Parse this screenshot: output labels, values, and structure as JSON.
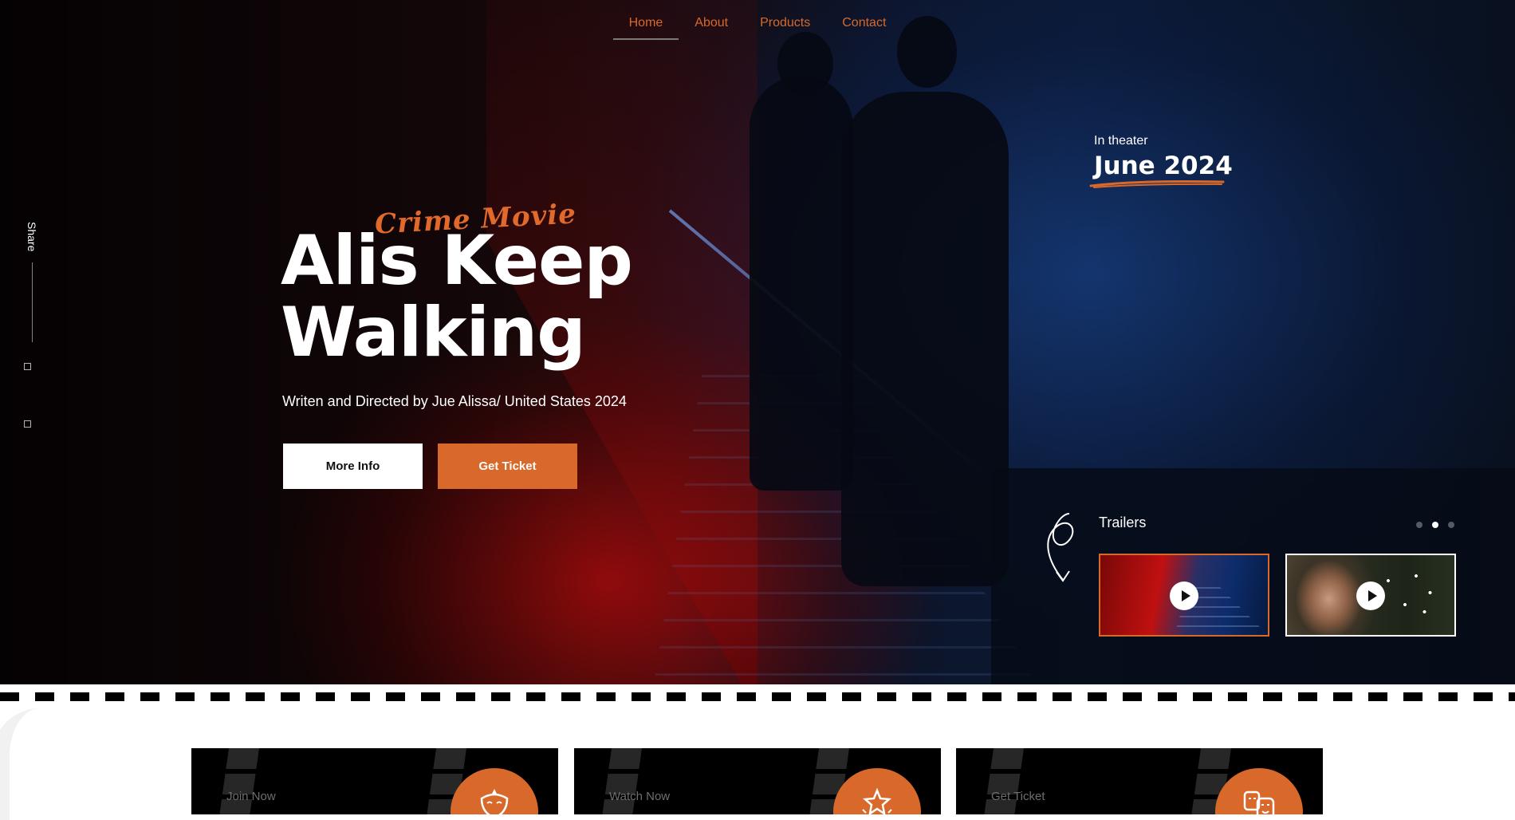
{
  "nav": {
    "items": [
      {
        "label": "Home",
        "active": true
      },
      {
        "label": "About",
        "active": false
      },
      {
        "label": "Products",
        "active": false
      },
      {
        "label": "Contact",
        "active": false
      }
    ]
  },
  "share": {
    "label": "Share",
    "icons": [
      "facebook-icon",
      "twitter-icon"
    ]
  },
  "hero": {
    "genre": "Crime Movie",
    "title": "Alis Keep Walking",
    "credits": "Writen and Directed by Jue Alissa/ United States 2024",
    "more_info_label": "More Info",
    "get_ticket_label": "Get Ticket"
  },
  "release": {
    "label": "In theater",
    "date": "June 2024"
  },
  "trailers": {
    "title": "Trailers",
    "active_page": 2,
    "page_count": 3,
    "thumbnails": [
      "trailer-stairs",
      "trailer-dandelion"
    ]
  },
  "features": {
    "cards": [
      {
        "eyebrow": "Join Now",
        "icon": "mask-icon"
      },
      {
        "eyebrow": "Watch Now",
        "icon": "star-trophy-icon"
      },
      {
        "eyebrow": "Get Ticket",
        "icon": "theater-masks-icon"
      }
    ]
  },
  "colors": {
    "accent": "#d8692b",
    "dark": "#000000",
    "text_light": "#ffffff"
  }
}
